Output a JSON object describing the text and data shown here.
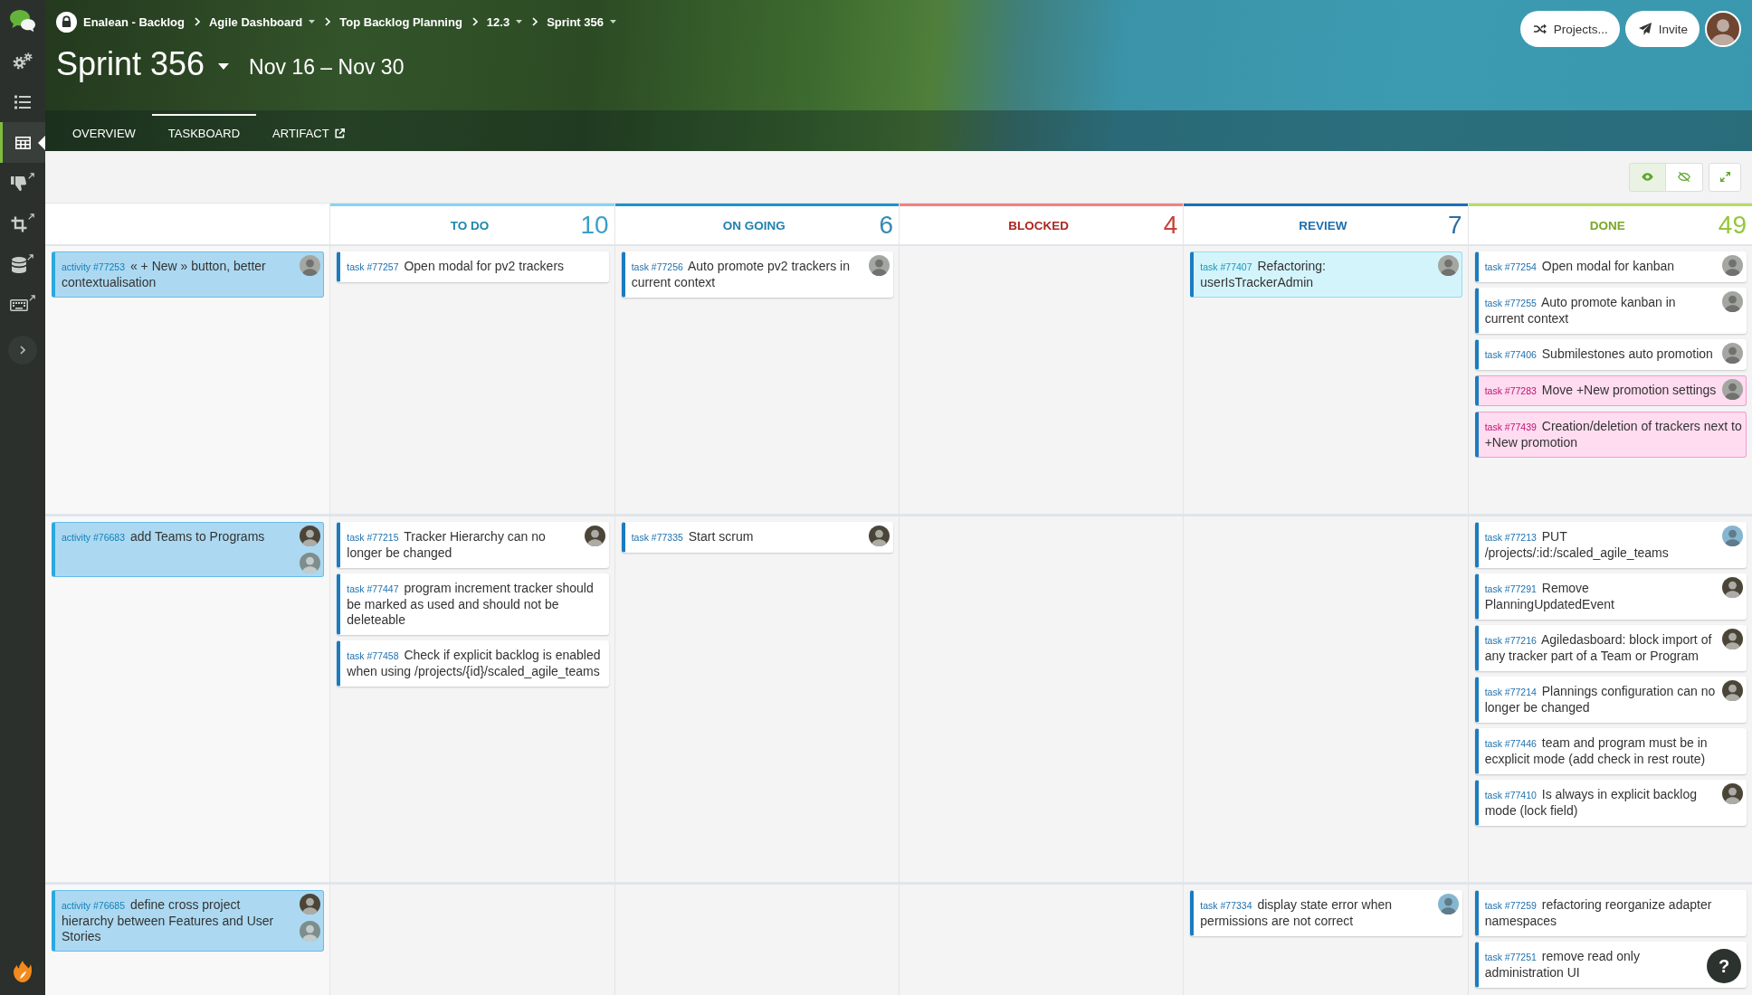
{
  "sidebar": {
    "tools": [
      {
        "kind": "gears",
        "external": false,
        "selected": false
      },
      {
        "kind": "list",
        "external": false,
        "selected": false
      },
      {
        "kind": "table",
        "external": false,
        "selected": true
      },
      {
        "kind": "thumbs-down",
        "external": true,
        "selected": false
      },
      {
        "kind": "crop",
        "external": true,
        "selected": false
      },
      {
        "kind": "database",
        "external": true,
        "selected": false
      },
      {
        "kind": "keyboard",
        "external": true,
        "selected": false
      }
    ]
  },
  "breadcrumb": [
    {
      "label": "Enalean - Backlog",
      "locked": true,
      "dropdown": false
    },
    {
      "label": "Agile Dashboard",
      "locked": false,
      "dropdown": true
    },
    {
      "label": "Top Backlog Planning",
      "locked": false,
      "dropdown": false
    },
    {
      "label": "12.3",
      "locked": false,
      "dropdown": true
    },
    {
      "label": "Sprint 356",
      "locked": false,
      "dropdown": true
    }
  ],
  "milestone": {
    "title": "Sprint 356",
    "dates": "Nov 16 – Nov 30"
  },
  "tabs": [
    {
      "label": "OVERVIEW",
      "selected": false,
      "external": false
    },
    {
      "label": "TASKBOARD",
      "selected": true,
      "external": false
    },
    {
      "label": "ARTIFACT",
      "selected": false,
      "external": true
    }
  ],
  "header_buttons": [
    {
      "kind": "projects",
      "label": "Projects..."
    },
    {
      "kind": "invite",
      "label": "Invite"
    }
  ],
  "user_avatar": {
    "color": "#6e4632"
  },
  "view_toggles": [
    {
      "kind": "show",
      "selected": true
    },
    {
      "kind": "hide",
      "selected": false
    }
  ],
  "columns": [
    {
      "label": "TO DO",
      "count": "10",
      "color": "#88d3f0"
    },
    {
      "label": "ON GOING",
      "count": "6",
      "color": "#1d93c8"
    },
    {
      "label": "BLOCKED",
      "count": "4",
      "color": "#f0837d"
    },
    {
      "label": "REVIEW",
      "count": "7",
      "color": "#1b6fb3"
    },
    {
      "label": "DONE",
      "count": "49",
      "color": "#b3dd67"
    }
  ],
  "rows": [
    {
      "parent": {
        "id": "activity #77253",
        "title": "« + New » button, better contextualisation",
        "color": "#acd9f1",
        "avatars": [
          {
            "color": "#a4a7a1"
          }
        ]
      },
      "cells": [
        {
          "cards": [
            {
              "id": "task #77257",
              "title": "Open modal for pv2 trackers",
              "color": "#ffffff"
            }
          ]
        },
        {
          "cards": [
            {
              "id": "task #77256",
              "title": "Auto promote pv2 trackers in current context",
              "color": "#ffffff",
              "avatars": [
                {
                  "color": "#a4a7a1"
                }
              ]
            }
          ]
        },
        {},
        {
          "cards": [
            {
              "id": "task #77407",
              "title": "Refactoring: userIsTrackerAdmin",
              "color": "#d4f4fc",
              "avatars": [
                {
                  "color": "#a4a7a1"
                }
              ]
            }
          ]
        },
        {
          "cards": [
            {
              "id": "task #77254",
              "title": "Open modal for kanban",
              "color": "#ffffff",
              "avatars": [
                {
                  "color": "#a4a7a1"
                }
              ]
            },
            {
              "id": "task #77255",
              "title": "Auto promote kanban in current context",
              "color": "#ffffff",
              "avatars": [
                {
                  "color": "#a4a7a1"
                }
              ]
            },
            {
              "id": "task #77406",
              "title": "Submilestones auto promotion",
              "color": "#ffffff",
              "avatars": [
                {
                  "color": "#a4a7a1"
                }
              ]
            },
            {
              "id": "task #77283",
              "title": "Move +New promotion settings",
              "color": "#ffdcf0",
              "avatars": [
                {
                  "color": "#a4a7a1"
                }
              ]
            },
            {
              "id": "task #77439",
              "title": "Creation/deletion of trackers next to +New promotion",
              "color": "#ffdcf0"
            }
          ]
        }
      ]
    },
    {
      "parent": {
        "id": "activity #76683",
        "title": "add Teams to Programs",
        "color": "#acd9f1",
        "avatars": [
          {
            "color": "#4b4538"
          },
          {
            "color": "#7d8e8c"
          }
        ]
      },
      "cells": [
        {
          "cards": [
            {
              "id": "task #77215",
              "title": "Tracker Hierarchy can no longer be changed",
              "color": "#ffffff",
              "avatars": [
                {
                  "color": "#4b4538"
                }
              ]
            },
            {
              "id": "task #77447",
              "title": "program increment tracker should be marked as used and should not be deleteable",
              "color": "#ffffff"
            },
            {
              "id": "task #77458",
              "title": "Check if explicit backlog is enabled when using /projects/{id}/scaled_agile_teams",
              "color": "#ffffff"
            }
          ]
        },
        {
          "cards": [
            {
              "id": "task #77335",
              "title": "Start scrum",
              "color": "#ffffff",
              "avatars": [
                {
                  "color": "#4b4538"
                }
              ]
            }
          ]
        },
        {},
        {},
        {
          "cards": [
            {
              "id": "task #77213",
              "title": "PUT /projects/:id:/scaled_agile_teams",
              "color": "#ffffff",
              "avatars": [
                {
                  "color": "#86b6cf"
                }
              ]
            },
            {
              "id": "task #77291",
              "title": "Remove PlanningUpdatedEvent",
              "color": "#ffffff",
              "avatars": [
                {
                  "color": "#4b4538"
                }
              ]
            },
            {
              "id": "task #77216",
              "title": "Agiledasboard: block import of any tracker part of a Team or Program",
              "color": "#ffffff",
              "avatars": [
                {
                  "color": "#4b4538"
                }
              ]
            },
            {
              "id": "task #77214",
              "title": "Plannings configuration can no longer be changed",
              "color": "#ffffff",
              "avatars": [
                {
                  "color": "#4b4538"
                }
              ]
            },
            {
              "id": "task #77446",
              "title": "team and program must be in ecxplicit mode (add check in rest route)",
              "color": "#ffffff"
            },
            {
              "id": "task #77410",
              "title": "Is always in explicit backlog mode (lock field)",
              "color": "#ffffff",
              "avatars": [
                {
                  "color": "#4b4538"
                }
              ]
            }
          ]
        }
      ]
    },
    {
      "parent": {
        "id": "activity #76685",
        "title": "define cross project hierarchy between Features and User Stories",
        "color": "#acd9f1",
        "avatars": [
          {
            "color": "#4b4538"
          },
          {
            "color": "#7d8e8c"
          }
        ]
      },
      "cells": [
        {},
        {},
        {},
        {
          "cards": [
            {
              "id": "task #77334",
              "title": "display state error when permissions are not correct",
              "color": "#ffffff",
              "avatars": [
                {
                  "color": "#86b6cf"
                }
              ]
            }
          ]
        },
        {
          "cards": [
            {
              "id": "task #77259",
              "title": "refactoring reorganize adapter namespaces",
              "color": "#ffffff"
            },
            {
              "id": "task #77251",
              "title": "remove read only administration UI",
              "color": "#ffffff"
            }
          ]
        }
      ]
    }
  ],
  "help_button": {
    "label": "?"
  }
}
